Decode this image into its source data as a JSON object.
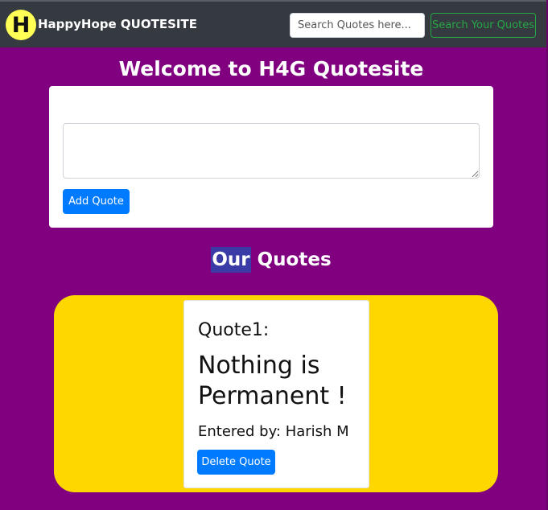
{
  "navbar": {
    "logo_letter": "H",
    "brand": "HappyHope QUOTESITE",
    "search_placeholder": "Search Quotes here...",
    "search_button": "Search Your Quotes"
  },
  "main": {
    "welcome_title": "Welcome to H4G Quotesite",
    "add_button": "Add Quote",
    "textarea_value": ""
  },
  "quotes_section": {
    "title_highlight": "Our",
    "title_rest": " Quotes",
    "quotes": [
      {
        "heading": "Quote1:",
        "text": "Nothing is Permanent !",
        "author": "Entered by: Harish M",
        "delete_label": "Delete Quote"
      }
    ]
  },
  "colors": {
    "page_bg": "#800080",
    "navbar_bg": "#343a40",
    "quotes_bg": "#ffd700",
    "primary": "#007bff",
    "success": "#28a745"
  }
}
